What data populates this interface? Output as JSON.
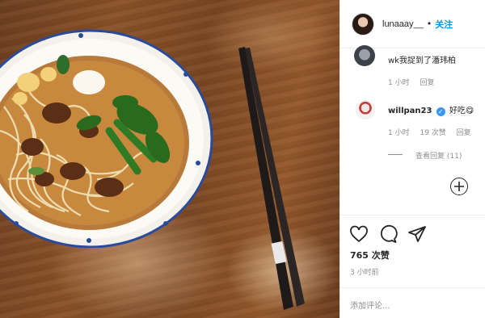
{
  "post": {
    "username": "lunaaay__",
    "separator": "•",
    "follow_label": "关注"
  },
  "comments": [
    {
      "text": "wk我捉到了潘玮柏",
      "time": "1 小时",
      "reply_label": "回复"
    },
    {
      "username": "willpan23",
      "verified_glyph": "✓",
      "text": "好吃😋",
      "time": "1 小时",
      "likes": "19 次赞",
      "reply_label": "回复",
      "view_replies": "查看回复 (11)"
    }
  ],
  "stats": {
    "likes": "765 次赞",
    "time_ago": "3 小时前"
  },
  "composer": {
    "placeholder": "添加评论..."
  },
  "icons": {
    "like": "heart-icon",
    "comment": "comment-bubble-icon",
    "share": "share-paper-plane-icon",
    "add": "plus-circle-icon"
  },
  "colors": {
    "accent": "#0095f6",
    "verified": "#3897f0",
    "muted": "#8e8e8e"
  }
}
